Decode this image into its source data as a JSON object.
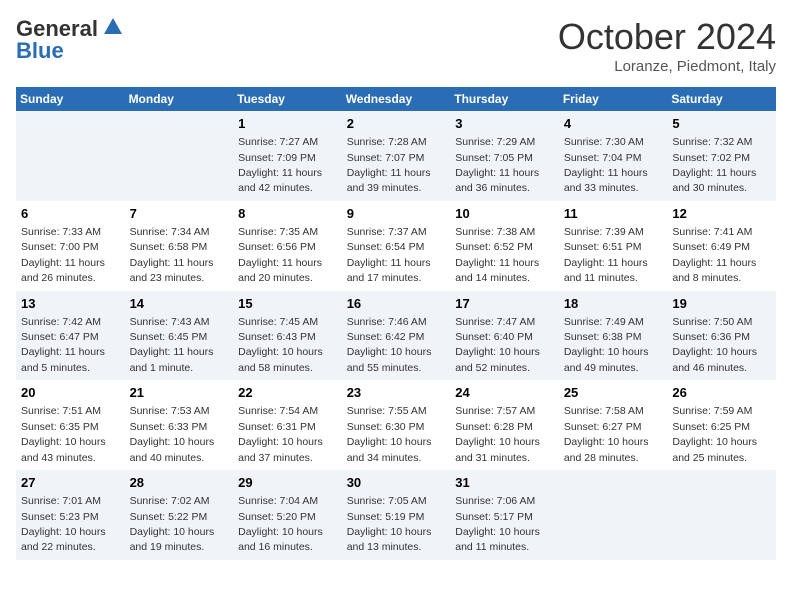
{
  "header": {
    "logo_general": "General",
    "logo_blue": "Blue",
    "month": "October 2024",
    "location": "Loranze, Piedmont, Italy"
  },
  "columns": [
    "Sunday",
    "Monday",
    "Tuesday",
    "Wednesday",
    "Thursday",
    "Friday",
    "Saturday"
  ],
  "weeks": [
    [
      {
        "day": "",
        "sunrise": "",
        "sunset": "",
        "daylight": ""
      },
      {
        "day": "",
        "sunrise": "",
        "sunset": "",
        "daylight": ""
      },
      {
        "day": "1",
        "sunrise": "Sunrise: 7:27 AM",
        "sunset": "Sunset: 7:09 PM",
        "daylight": "Daylight: 11 hours and 42 minutes."
      },
      {
        "day": "2",
        "sunrise": "Sunrise: 7:28 AM",
        "sunset": "Sunset: 7:07 PM",
        "daylight": "Daylight: 11 hours and 39 minutes."
      },
      {
        "day": "3",
        "sunrise": "Sunrise: 7:29 AM",
        "sunset": "Sunset: 7:05 PM",
        "daylight": "Daylight: 11 hours and 36 minutes."
      },
      {
        "day": "4",
        "sunrise": "Sunrise: 7:30 AM",
        "sunset": "Sunset: 7:04 PM",
        "daylight": "Daylight: 11 hours and 33 minutes."
      },
      {
        "day": "5",
        "sunrise": "Sunrise: 7:32 AM",
        "sunset": "Sunset: 7:02 PM",
        "daylight": "Daylight: 11 hours and 30 minutes."
      }
    ],
    [
      {
        "day": "6",
        "sunrise": "Sunrise: 7:33 AM",
        "sunset": "Sunset: 7:00 PM",
        "daylight": "Daylight: 11 hours and 26 minutes."
      },
      {
        "day": "7",
        "sunrise": "Sunrise: 7:34 AM",
        "sunset": "Sunset: 6:58 PM",
        "daylight": "Daylight: 11 hours and 23 minutes."
      },
      {
        "day": "8",
        "sunrise": "Sunrise: 7:35 AM",
        "sunset": "Sunset: 6:56 PM",
        "daylight": "Daylight: 11 hours and 20 minutes."
      },
      {
        "day": "9",
        "sunrise": "Sunrise: 7:37 AM",
        "sunset": "Sunset: 6:54 PM",
        "daylight": "Daylight: 11 hours and 17 minutes."
      },
      {
        "day": "10",
        "sunrise": "Sunrise: 7:38 AM",
        "sunset": "Sunset: 6:52 PM",
        "daylight": "Daylight: 11 hours and 14 minutes."
      },
      {
        "day": "11",
        "sunrise": "Sunrise: 7:39 AM",
        "sunset": "Sunset: 6:51 PM",
        "daylight": "Daylight: 11 hours and 11 minutes."
      },
      {
        "day": "12",
        "sunrise": "Sunrise: 7:41 AM",
        "sunset": "Sunset: 6:49 PM",
        "daylight": "Daylight: 11 hours and 8 minutes."
      }
    ],
    [
      {
        "day": "13",
        "sunrise": "Sunrise: 7:42 AM",
        "sunset": "Sunset: 6:47 PM",
        "daylight": "Daylight: 11 hours and 5 minutes."
      },
      {
        "day": "14",
        "sunrise": "Sunrise: 7:43 AM",
        "sunset": "Sunset: 6:45 PM",
        "daylight": "Daylight: 11 hours and 1 minute."
      },
      {
        "day": "15",
        "sunrise": "Sunrise: 7:45 AM",
        "sunset": "Sunset: 6:43 PM",
        "daylight": "Daylight: 10 hours and 58 minutes."
      },
      {
        "day": "16",
        "sunrise": "Sunrise: 7:46 AM",
        "sunset": "Sunset: 6:42 PM",
        "daylight": "Daylight: 10 hours and 55 minutes."
      },
      {
        "day": "17",
        "sunrise": "Sunrise: 7:47 AM",
        "sunset": "Sunset: 6:40 PM",
        "daylight": "Daylight: 10 hours and 52 minutes."
      },
      {
        "day": "18",
        "sunrise": "Sunrise: 7:49 AM",
        "sunset": "Sunset: 6:38 PM",
        "daylight": "Daylight: 10 hours and 49 minutes."
      },
      {
        "day": "19",
        "sunrise": "Sunrise: 7:50 AM",
        "sunset": "Sunset: 6:36 PM",
        "daylight": "Daylight: 10 hours and 46 minutes."
      }
    ],
    [
      {
        "day": "20",
        "sunrise": "Sunrise: 7:51 AM",
        "sunset": "Sunset: 6:35 PM",
        "daylight": "Daylight: 10 hours and 43 minutes."
      },
      {
        "day": "21",
        "sunrise": "Sunrise: 7:53 AM",
        "sunset": "Sunset: 6:33 PM",
        "daylight": "Daylight: 10 hours and 40 minutes."
      },
      {
        "day": "22",
        "sunrise": "Sunrise: 7:54 AM",
        "sunset": "Sunset: 6:31 PM",
        "daylight": "Daylight: 10 hours and 37 minutes."
      },
      {
        "day": "23",
        "sunrise": "Sunrise: 7:55 AM",
        "sunset": "Sunset: 6:30 PM",
        "daylight": "Daylight: 10 hours and 34 minutes."
      },
      {
        "day": "24",
        "sunrise": "Sunrise: 7:57 AM",
        "sunset": "Sunset: 6:28 PM",
        "daylight": "Daylight: 10 hours and 31 minutes."
      },
      {
        "day": "25",
        "sunrise": "Sunrise: 7:58 AM",
        "sunset": "Sunset: 6:27 PM",
        "daylight": "Daylight: 10 hours and 28 minutes."
      },
      {
        "day": "26",
        "sunrise": "Sunrise: 7:59 AM",
        "sunset": "Sunset: 6:25 PM",
        "daylight": "Daylight: 10 hours and 25 minutes."
      }
    ],
    [
      {
        "day": "27",
        "sunrise": "Sunrise: 7:01 AM",
        "sunset": "Sunset: 5:23 PM",
        "daylight": "Daylight: 10 hours and 22 minutes."
      },
      {
        "day": "28",
        "sunrise": "Sunrise: 7:02 AM",
        "sunset": "Sunset: 5:22 PM",
        "daylight": "Daylight: 10 hours and 19 minutes."
      },
      {
        "day": "29",
        "sunrise": "Sunrise: 7:04 AM",
        "sunset": "Sunset: 5:20 PM",
        "daylight": "Daylight: 10 hours and 16 minutes."
      },
      {
        "day": "30",
        "sunrise": "Sunrise: 7:05 AM",
        "sunset": "Sunset: 5:19 PM",
        "daylight": "Daylight: 10 hours and 13 minutes."
      },
      {
        "day": "31",
        "sunrise": "Sunrise: 7:06 AM",
        "sunset": "Sunset: 5:17 PM",
        "daylight": "Daylight: 10 hours and 11 minutes."
      },
      {
        "day": "",
        "sunrise": "",
        "sunset": "",
        "daylight": ""
      },
      {
        "day": "",
        "sunrise": "",
        "sunset": "",
        "daylight": ""
      }
    ]
  ]
}
